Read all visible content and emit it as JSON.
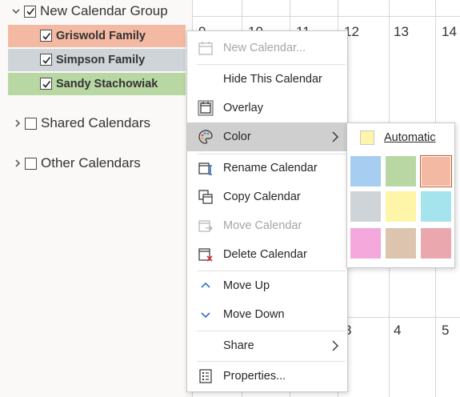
{
  "folder_pane": {
    "group": {
      "label": "New Calendar Group"
    },
    "calendars": [
      {
        "label": "Griswold Family",
        "color": "#f4b9a3"
      },
      {
        "label": "Simpson Family",
        "color": "#cfd4d8"
      },
      {
        "label": "Sandy Stachowiak",
        "color": "#b8d7a3"
      }
    ],
    "shared": {
      "label": "Shared Calendars"
    },
    "other": {
      "label": "Other Calendars"
    }
  },
  "calendar_grid": {
    "top_dates": [
      "9",
      "10",
      "11",
      "12",
      "13",
      "14"
    ],
    "bottom_dates": [
      "3",
      "4",
      "5"
    ]
  },
  "context_menu": {
    "items": [
      {
        "label": "New Calendar...",
        "icon": "new-calendar-icon",
        "disabled": true
      },
      {
        "label": "Hide This Calendar",
        "icon": "",
        "disabled": false
      },
      {
        "label": "Overlay",
        "icon": "overlay-icon",
        "disabled": false
      },
      {
        "label": "Color",
        "icon": "palette-icon",
        "disabled": false,
        "submenu": true,
        "highlighted": true
      },
      {
        "label": "Rename Calendar",
        "icon": "rename-icon",
        "disabled": false
      },
      {
        "label": "Copy Calendar",
        "icon": "copy-icon",
        "disabled": false
      },
      {
        "label": "Move Calendar",
        "icon": "move-icon",
        "disabled": true
      },
      {
        "label": "Delete Calendar",
        "icon": "delete-icon",
        "disabled": false
      },
      {
        "label": "Move Up",
        "icon": "chevron-up-icon",
        "disabled": false
      },
      {
        "label": "Move Down",
        "icon": "chevron-down-icon",
        "disabled": false
      },
      {
        "label": "Share",
        "icon": "",
        "disabled": false,
        "submenu": true
      },
      {
        "label": "Properties...",
        "icon": "properties-icon",
        "disabled": false
      }
    ]
  },
  "color_submenu": {
    "automatic": {
      "label": "Automatic",
      "color": "#fef5a8"
    },
    "swatches": [
      {
        "color": "#a7cdf0",
        "selected": false
      },
      {
        "color": "#b8d7a3",
        "selected": false
      },
      {
        "color": "#f4b9a3",
        "selected": true
      },
      {
        "color": "#cfd4d8",
        "selected": false
      },
      {
        "color": "#fef5a8",
        "selected": false
      },
      {
        "color": "#a5e4ec",
        "selected": false
      },
      {
        "color": "#f4a8dc",
        "selected": false
      },
      {
        "color": "#dcc4ae",
        "selected": false
      },
      {
        "color": "#eba7ae",
        "selected": false
      }
    ]
  }
}
